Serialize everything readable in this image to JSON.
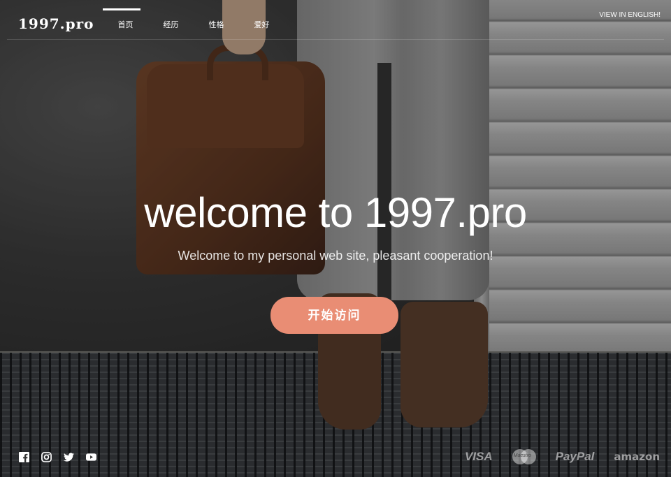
{
  "brand": {
    "logo": "1997.pro"
  },
  "nav": {
    "items": [
      {
        "label": "首页",
        "active": true
      },
      {
        "label": "经历",
        "active": false
      },
      {
        "label": "性格",
        "active": false
      },
      {
        "label": "爱好",
        "active": false
      }
    ],
    "language_link": "VIEW IN ENGLISH!"
  },
  "hero": {
    "title": "welcome to 1997.pro",
    "subtitle": "Welcome to my personal web site, pleasant cooperation!",
    "cta_label": "开始访问"
  },
  "footer": {
    "social_icons": [
      "facebook-icon",
      "instagram-icon",
      "twitter-icon",
      "youtube-icon"
    ],
    "payments": {
      "visa": "VISA",
      "mastercard": "Maestro",
      "paypal": "PayPal",
      "amazon": "amazon"
    }
  },
  "colors": {
    "accent": "#e98d74",
    "text": "#ffffff"
  }
}
